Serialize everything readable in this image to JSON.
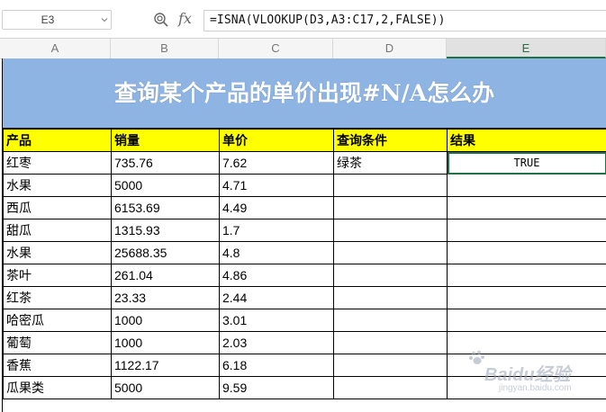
{
  "formula_bar": {
    "name_box": "E3",
    "fx_label": "fx",
    "formula": "=ISNA(VLOOKUP(D3,A3:C17,2,FALSE))"
  },
  "columns": [
    "A",
    "B",
    "C",
    "D",
    "E"
  ],
  "active_column": "E",
  "title": "查询某个产品的单价出现#N/A怎么办",
  "header": [
    "产品",
    "销量",
    "单价",
    "查询条件",
    "结果"
  ],
  "rows": [
    [
      "红枣",
      "735.76",
      "7.62",
      "绿茶",
      "TRUE"
    ],
    [
      "水果",
      "5000",
      "4.71",
      "",
      ""
    ],
    [
      "西瓜",
      "6153.69",
      "4.49",
      "",
      ""
    ],
    [
      "甜瓜",
      "1315.93",
      "1.7",
      "",
      ""
    ],
    [
      "水果",
      "25688.35",
      "4.8",
      "",
      ""
    ],
    [
      "茶叶",
      "261.04",
      "4.86",
      "",
      ""
    ],
    [
      "红茶",
      "23.33",
      "2.44",
      "",
      ""
    ],
    [
      "哈密瓜",
      "1000",
      "3.01",
      "",
      ""
    ],
    [
      "葡萄",
      "1000",
      "2.03",
      "",
      ""
    ],
    [
      "香蕉",
      "1122.17",
      "6.18",
      "",
      ""
    ],
    [
      "瓜果类",
      "5000",
      "9.59",
      "",
      ""
    ]
  ],
  "watermark": {
    "brand": "Baidu经验",
    "sub": "jingyan.baidu.com"
  },
  "colors": {
    "title_bg": "#8eb4e3",
    "header_bg": "#ffff00",
    "selection": "#217346"
  }
}
